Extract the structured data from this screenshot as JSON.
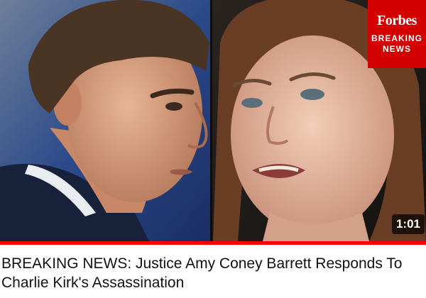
{
  "video": {
    "title": "BREAKING NEWS: Justice Amy Coney Barrett Responds To Charlie Kirk's Assassination",
    "duration": "1:01",
    "progress": 1.0,
    "progress_color": "#ff0000"
  },
  "badge": {
    "brand": "Forbes",
    "line1": "BREAKING",
    "line2": "NEWS",
    "color": "#d30000"
  }
}
